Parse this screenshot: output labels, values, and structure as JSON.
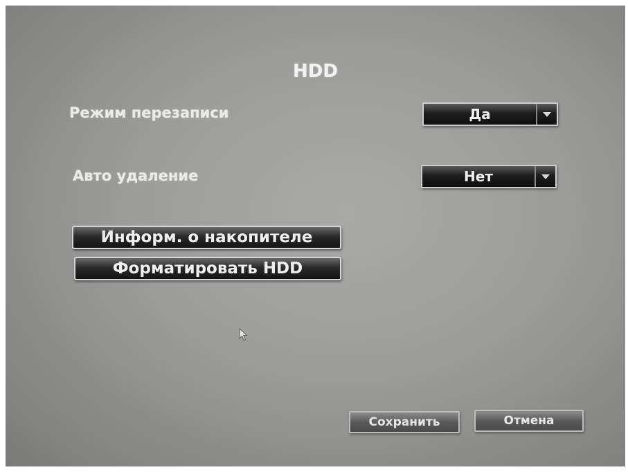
{
  "dialog": {
    "title": "HDD",
    "overwrite": {
      "label": "Режим перезаписи",
      "value": "Да"
    },
    "auto_delete": {
      "label": "Авто удаление",
      "value": "Нет"
    },
    "buttons": {
      "drive_info": "Информ. о накопителе",
      "format_hdd": "Форматировать HDD",
      "save": "Сохранить",
      "cancel": "Отмена"
    }
  },
  "icons": {
    "dropdown": "chevron-down-icon",
    "cursor": "mouse-pointer-icon"
  },
  "colors": {
    "background": "#9c9d9b",
    "control": "#141414",
    "text": "#ecebe8"
  }
}
